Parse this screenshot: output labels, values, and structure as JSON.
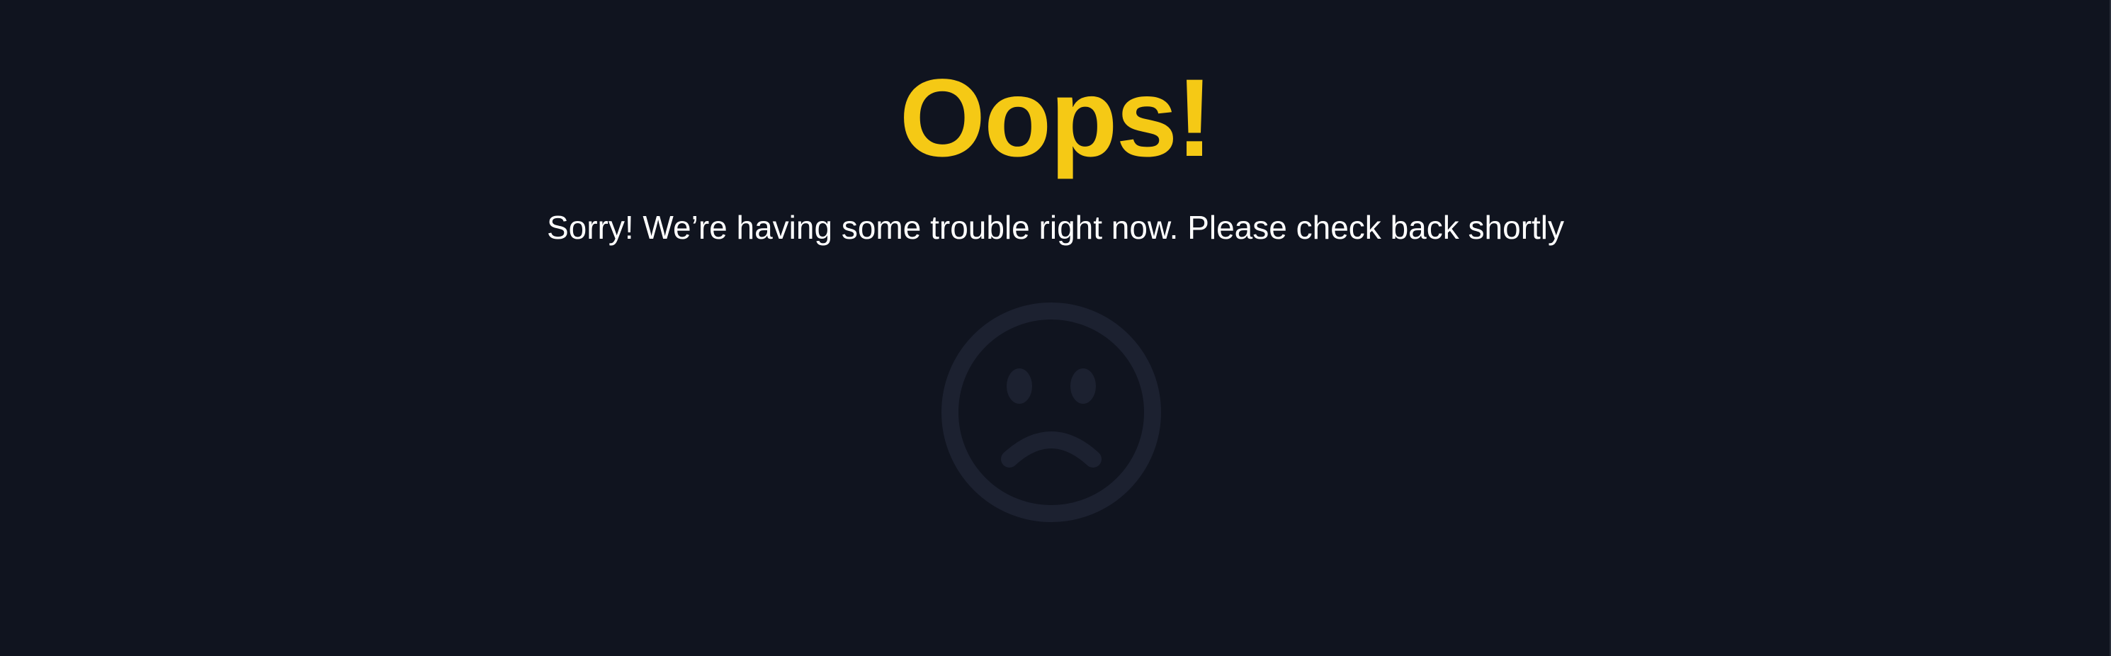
{
  "error_page": {
    "title": "Oops!",
    "message": "Sorry! We’re having some trouble right now. Please check back shortly",
    "icon": "sad-face-icon"
  },
  "colors": {
    "background": "#10141f",
    "title": "#f5c915",
    "message": "#ffffff",
    "icon": "#1c2130"
  }
}
